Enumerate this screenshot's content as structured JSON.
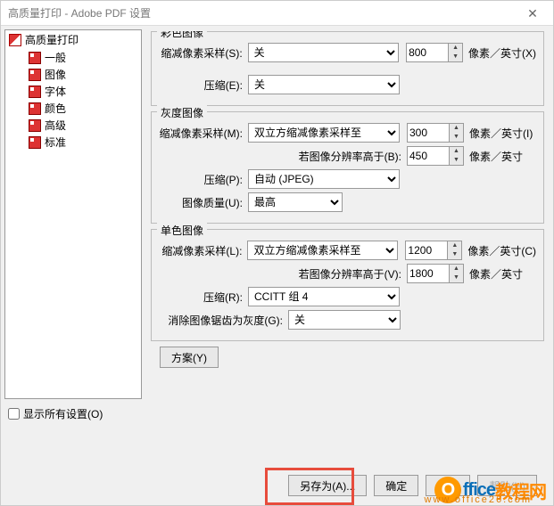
{
  "window": {
    "title": "高质量打印 - Adobe PDF 设置"
  },
  "tree": {
    "root": "高质量打印",
    "items": [
      "一般",
      "图像",
      "字体",
      "颜色",
      "高级",
      "标准"
    ]
  },
  "show_all_label": "显示所有设置(O)",
  "groups": {
    "color": {
      "title": "彩色图像",
      "downsample_label": "缩减像素采样(S):",
      "downsample_value": "关",
      "ppi_value": "800",
      "unit_x": "像素／英寸(X)",
      "compress_label": "压缩(E):",
      "compress_value": "关"
    },
    "gray": {
      "title": "灰度图像",
      "downsample_label": "缩减像素采样(M):",
      "downsample_value": "双立方缩减像素采样至",
      "ppi_value": "300",
      "unit_i": "像素／英寸(I)",
      "above_label": "若图像分辨率高于(B):",
      "above_value": "450",
      "unit_plain": "像素／英寸",
      "compress_label": "压缩(P):",
      "compress_value": "自动 (JPEG)",
      "quality_label": "图像质量(U):",
      "quality_value": "最高"
    },
    "mono": {
      "title": "单色图像",
      "downsample_label": "缩减像素采样(L):",
      "downsample_value": "双立方缩减像素采样至",
      "ppi_value": "1200",
      "unit_c": "像素／英寸(C)",
      "above_label": "若图像分辨率高于(V):",
      "above_value": "1800",
      "unit_plain": "像素／英寸",
      "compress_label": "压缩(R):",
      "compress_value": "CCITT 组 4",
      "antialias_label": "消除图像锯齿为灰度(G):",
      "antialias_value": "关"
    }
  },
  "scheme_button": "方案(Y)",
  "footer": {
    "saveas": "另存为(A)...",
    "ok": "确定",
    "cancel": "取消",
    "help": "帮助(H)"
  },
  "watermark": {
    "text1": "ffice",
    "text2": "教程网",
    "sub": "www.office26.com"
  }
}
